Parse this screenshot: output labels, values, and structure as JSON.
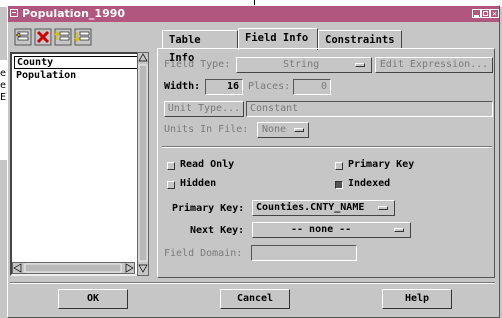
{
  "window": {
    "title": "Population_1990"
  },
  "backdrop": {
    "fragments": [
      "er",
      "e",
      "El"
    ]
  },
  "toolbar": {
    "icons": [
      "insert-field-icon",
      "delete-field-icon",
      "move-up-icon",
      "move-down-icon"
    ]
  },
  "fields_list": {
    "items": [
      "County",
      "Population"
    ],
    "selected": "County"
  },
  "tabs": [
    {
      "label": "Table Info",
      "active": false
    },
    {
      "label": "Field Info",
      "active": true
    },
    {
      "label": "Constraints",
      "active": false
    }
  ],
  "field_info": {
    "field_type_label": "Field Type:",
    "field_type_value": "String",
    "edit_expression_label": "Edit Expression...",
    "width_label": "Width:",
    "width_value": "16",
    "places_label": "Places:",
    "places_value": "0",
    "unit_type_label": "Unit Type...",
    "unit_type_value": "Constant",
    "units_in_file_label": "Units In File:",
    "units_in_file_value": "None",
    "read_only_label": "Read Only",
    "read_only_checked": false,
    "primary_key_check_label": "Primary Key",
    "primary_key_checked": false,
    "hidden_label": "Hidden",
    "hidden_checked": false,
    "indexed_label": "Indexed",
    "indexed_checked": true,
    "primary_key_label": "Primary Key:",
    "primary_key_value": "Counties.CNTY_NAME",
    "next_key_label": "Next Key:",
    "next_key_value": "-- none --",
    "field_domain_label": "Field Domain:",
    "field_domain_value": ""
  },
  "buttons": {
    "ok": "OK",
    "cancel": "Cancel",
    "help": "Help"
  },
  "colors": {
    "titlebar": "#b1567f",
    "panel": "#c6c6c6"
  }
}
